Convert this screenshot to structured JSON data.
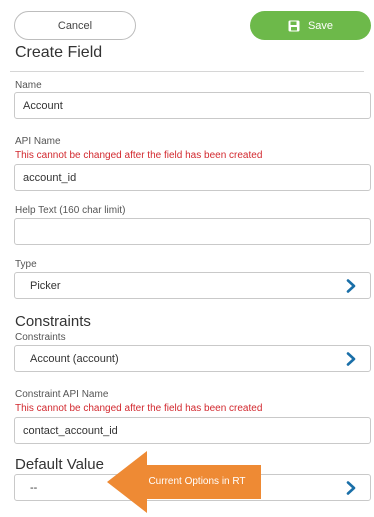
{
  "toolbar": {
    "cancel_label": "Cancel",
    "save_label": "Save",
    "save_icon": "floppy-disk-icon"
  },
  "page": {
    "title": "Create Field"
  },
  "fields": {
    "name": {
      "label": "Name",
      "value": "Account"
    },
    "api_name": {
      "label": "API Name",
      "warning": "This cannot be changed after the field has been created",
      "value": "account_id"
    },
    "help_text": {
      "label": "Help Text (160 char limit)",
      "value": ""
    },
    "type": {
      "label": "Type",
      "value": "Picker"
    }
  },
  "constraints": {
    "heading": "Constraints",
    "label": "Constraints",
    "value": "Account (account)",
    "api_label": "Constraint API Name",
    "api_warning": "This cannot be changed after the field has been created",
    "api_value": "contact_account_id"
  },
  "default_value": {
    "heading": "Default Value",
    "value": "--"
  },
  "annotation": {
    "text": "Current Options in RT",
    "color": "#ee8a34"
  },
  "colors": {
    "save_green": "#6db94a",
    "warning_red": "#d2282e",
    "chevron_blue": "#1a6fa8"
  }
}
